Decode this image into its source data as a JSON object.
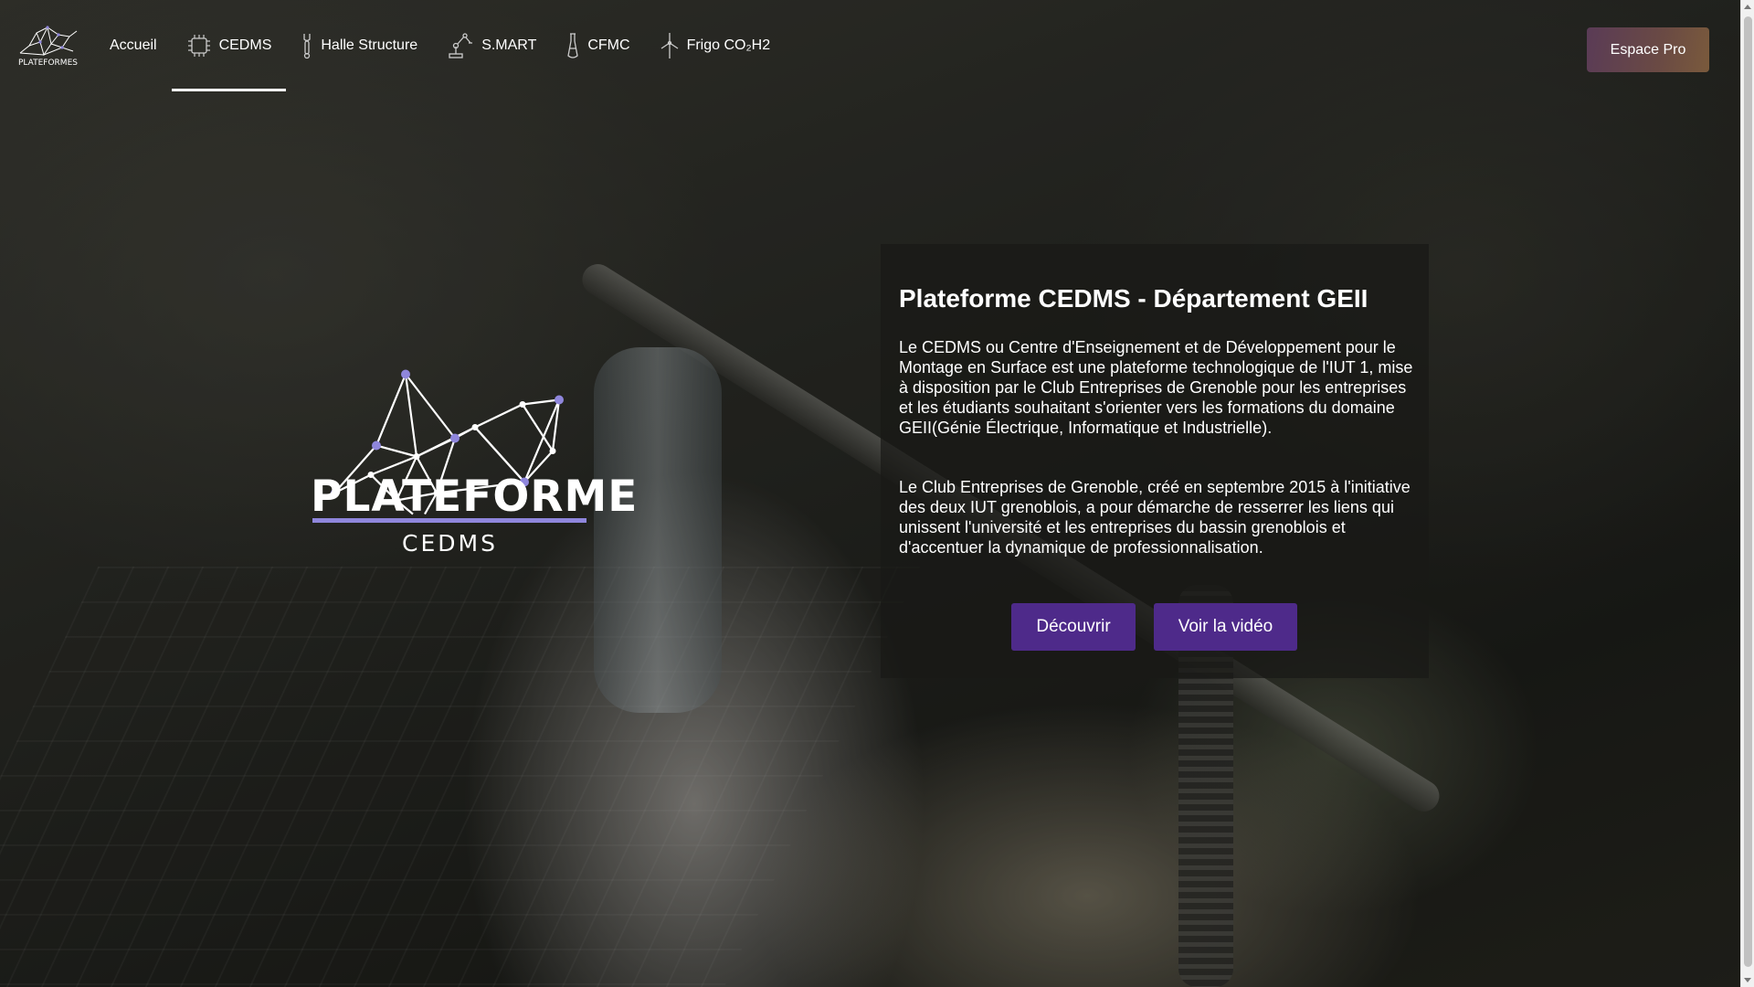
{
  "header": {
    "logo_text": "PLATEFORMES",
    "nav": [
      {
        "label": "Accueil",
        "icon": "none",
        "active": false
      },
      {
        "label": "CEDMS",
        "icon": "chip-icon",
        "active": true
      },
      {
        "label": "Halle Structure",
        "icon": "wrench-icon",
        "active": false
      },
      {
        "label": "S.MART",
        "icon": "robot-arm-icon",
        "active": false
      },
      {
        "label": "CFMC",
        "icon": "vial-icon",
        "active": false
      },
      {
        "label": "Frigo CO₂H2",
        "icon": "wind-turbine-icon",
        "active": false
      }
    ],
    "espace_pro_label": "Espace Pro"
  },
  "brand": {
    "word": "PLATEFORME",
    "sub": "CEDMS",
    "accent_color": "#8f86dc"
  },
  "card": {
    "title": "Plateforme CEDMS - Département GEII",
    "paragraph1": "Le CEDMS ou Centre d'Enseignement et de Développement pour le Montage en Surface est une plateforme technologique de l'IUT 1, mise à disposition par le Club Entreprises de Grenoble pour les entreprises et les étudiants souhaitant s'orienter vers les formations du domaine GEII(Génie Électrique, Informatique et Industrielle).",
    "paragraph2": "Le Club Entreprises de Grenoble, créé en septembre 2015 à l'initiative des deux IUT grenoblois, a pour démarche de resserrer les liens qui unissent l'université et les entreprises du bassin grenoblois et d'accentuer la dynamique de professionnalisation.",
    "discover_label": "Découvrir",
    "video_label": "Voir la vidéo",
    "button_color": "#4e2a8a"
  }
}
